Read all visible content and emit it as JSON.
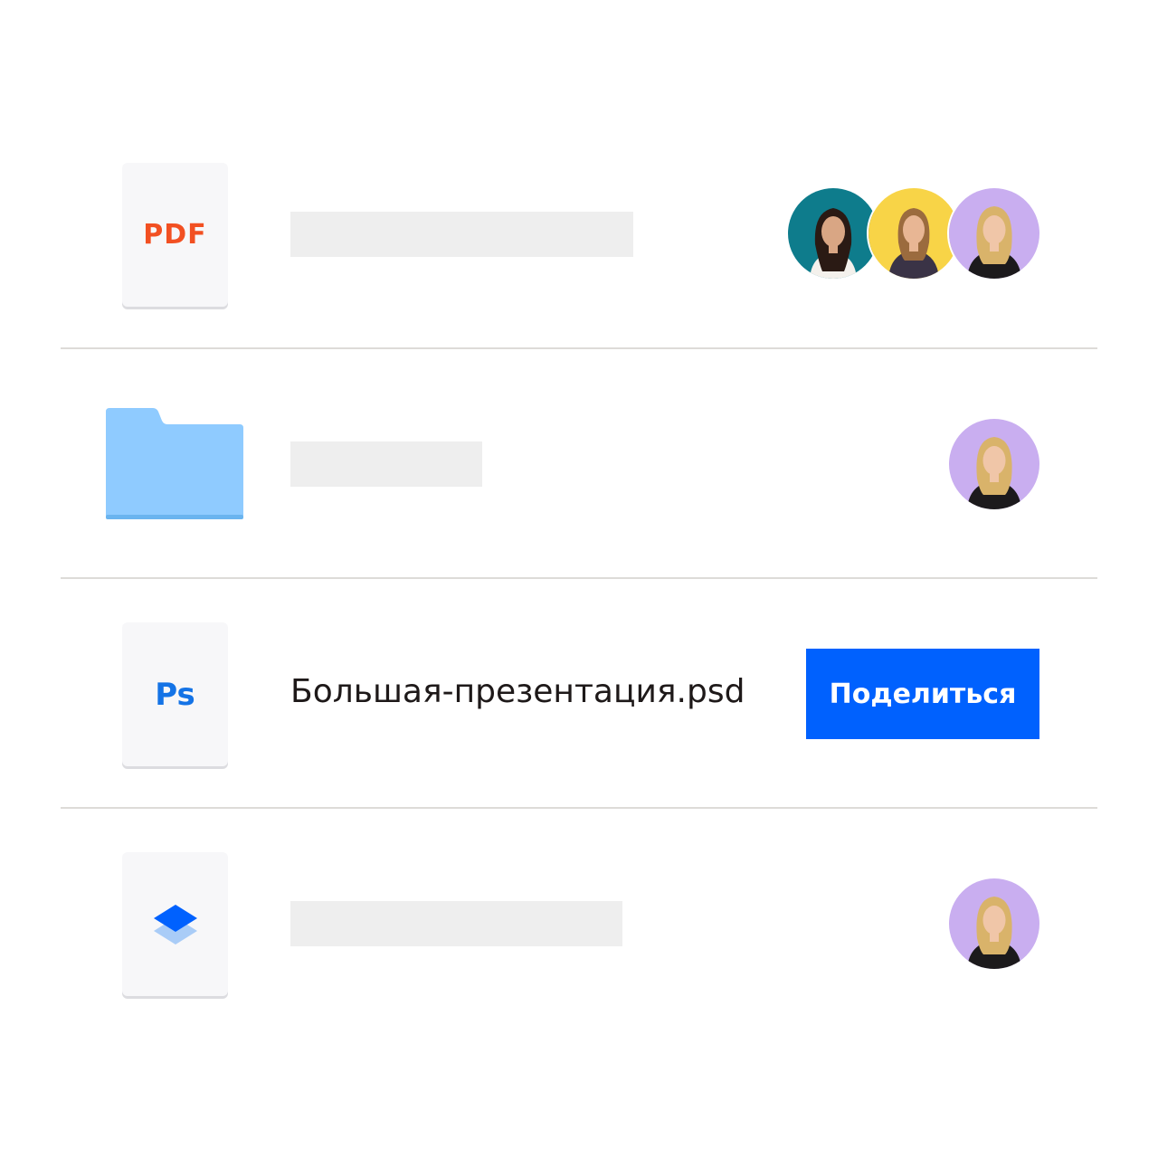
{
  "files": [
    {
      "type": "pdf",
      "type_label": "PDF",
      "icon": "pdf-file-icon",
      "name": "",
      "shared_with": [
        "avatar-teal",
        "avatar-yellow",
        "avatar-lavender"
      ]
    },
    {
      "type": "folder",
      "icon": "folder-icon",
      "name": "",
      "shared_with": [
        "avatar-lavender"
      ]
    },
    {
      "type": "psd",
      "type_label": "Ps",
      "icon": "photoshop-file-icon",
      "name": "Большая-презентация.psd",
      "action_label": "Поделиться"
    },
    {
      "type": "paper",
      "icon": "dropbox-paper-icon",
      "name": "",
      "shared_with": [
        "avatar-lavender"
      ]
    }
  ],
  "colors": {
    "accent": "#0061fe",
    "pdf": "#f25022",
    "photoshop": "#1473e6",
    "folder": "#8fcbff",
    "avatar_teal": "#0e7c8c",
    "avatar_yellow": "#f8d447",
    "avatar_lavender": "#c9aef0"
  }
}
